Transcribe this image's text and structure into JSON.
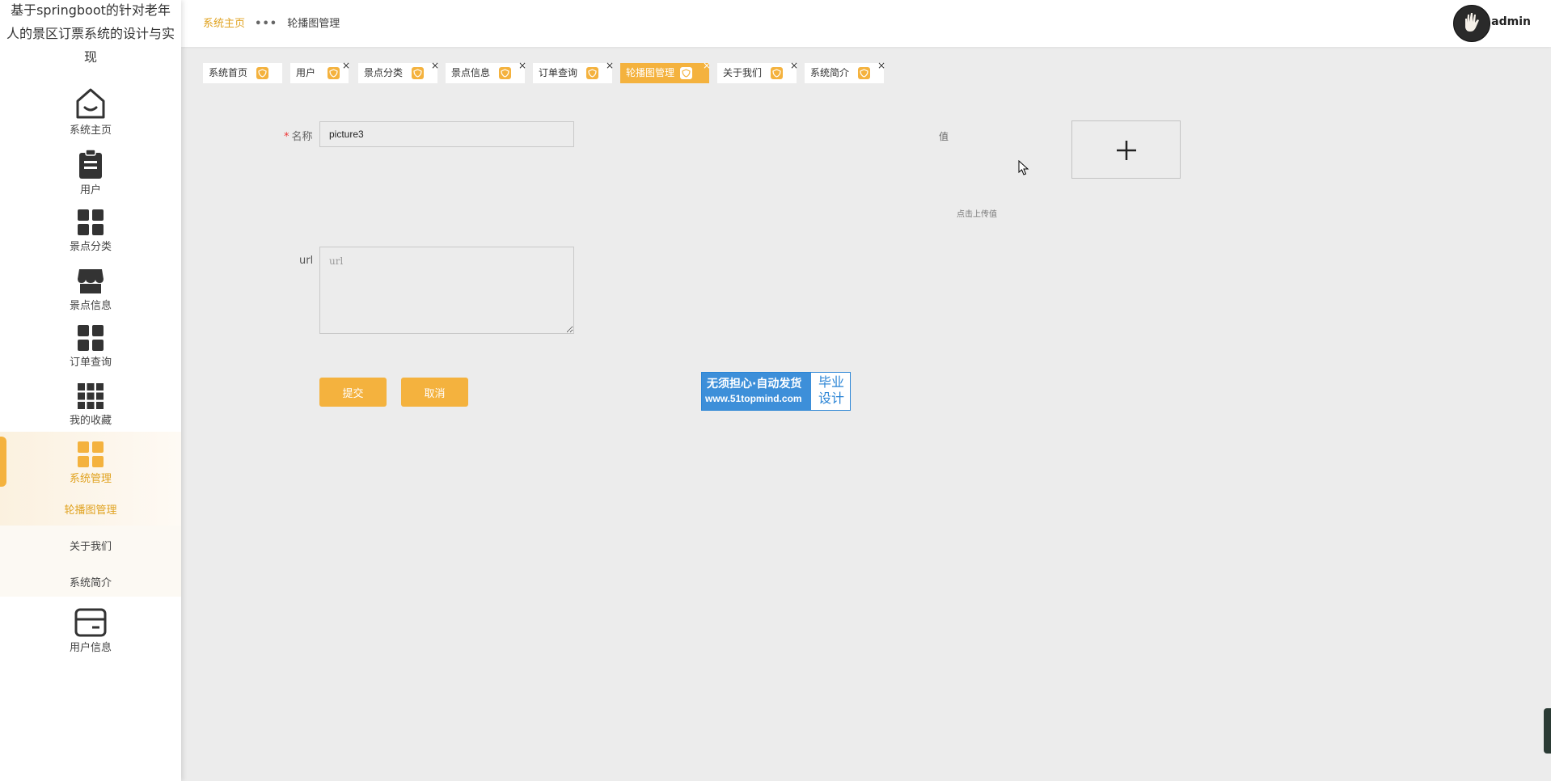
{
  "sidebar": {
    "system_title": "基于springboot的针对老年人的景区订票系统的设计与实现",
    "items": [
      {
        "label": "系统主页",
        "icon": "home-icon"
      },
      {
        "label": "用户",
        "icon": "clipboard-icon"
      },
      {
        "label": "景点分类",
        "icon": "grid-icon"
      },
      {
        "label": "景点信息",
        "icon": "shop-icon"
      },
      {
        "label": "订单查询",
        "icon": "grid-icon"
      },
      {
        "label": "我的收藏",
        "icon": "grid9-icon"
      },
      {
        "label": "系统管理",
        "icon": "grid-icon"
      },
      {
        "label": "用户信息",
        "icon": "card-icon"
      }
    ],
    "submenu": [
      {
        "label": "轮播图管理"
      },
      {
        "label": "关于我们"
      },
      {
        "label": "系统简介"
      }
    ]
  },
  "header": {
    "breadcrumb_home": "系统主页",
    "breadcrumb_sep": "•••",
    "breadcrumb_current": "轮播图管理",
    "username": "admin"
  },
  "tabs": [
    {
      "label": "系统首页",
      "closable": false,
      "active": false
    },
    {
      "label": "用户",
      "closable": true,
      "active": false
    },
    {
      "label": "景点分类",
      "closable": true,
      "active": false
    },
    {
      "label": "景点信息",
      "closable": true,
      "active": false
    },
    {
      "label": "订单查询",
      "closable": true,
      "active": false
    },
    {
      "label": "轮播图管理",
      "closable": true,
      "active": true
    },
    {
      "label": "关于我们",
      "closable": true,
      "active": false
    },
    {
      "label": "系统简介",
      "closable": true,
      "active": false
    }
  ],
  "form": {
    "name_label": "名称",
    "name_value": "picture3",
    "url_label": "url",
    "url_placeholder": "url",
    "value_label": "值",
    "upload_hint": "点击上传值",
    "submit_label": "提交",
    "cancel_label": "取消"
  },
  "watermark": {
    "line1": "无须担心·自动发货",
    "line2": "www.51topmind.com",
    "right_line1": "毕业",
    "right_line2": "设计"
  },
  "colors": {
    "accent": "#f4b23e",
    "accent_text": "#e0a21f",
    "background": "#ececec"
  }
}
